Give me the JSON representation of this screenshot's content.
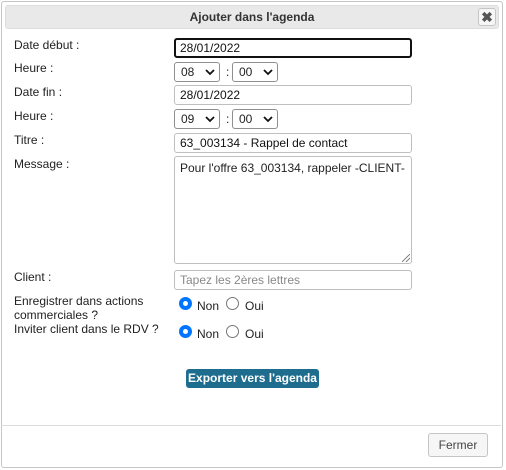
{
  "dialog": {
    "title": "Ajouter dans l'agenda",
    "close_icon": "close-icon"
  },
  "form": {
    "date_debut_label": "Date début :",
    "date_debut_value": "28/01/2022",
    "heure1_label": "Heure :",
    "heure1_hour": "08",
    "heure1_minute": "00",
    "date_fin_label": "Date fin :",
    "date_fin_value": "28/01/2022",
    "heure2_label": "Heure :",
    "heure2_hour": "09",
    "heure2_minute": "00",
    "colon": ":",
    "titre_label": "Titre :",
    "titre_value": "63_003134 - Rappel de contact",
    "message_label": "Message :",
    "message_value": "Pour l'offre 63_003134, rappeler -CLIENT-",
    "client_label": "Client :",
    "client_placeholder": "Tapez les 2ères lettres",
    "enregistrer_label": "Enregistrer dans actions commerciales ?",
    "inviter_label": "Inviter client dans le RDV ?",
    "option_non": "Non",
    "option_oui": "Oui",
    "enregistrer_selected": "Non",
    "inviter_selected": "Non"
  },
  "actions": {
    "export_label": "Exporter vers l'agenda",
    "fermer_label": "Fermer"
  }
}
